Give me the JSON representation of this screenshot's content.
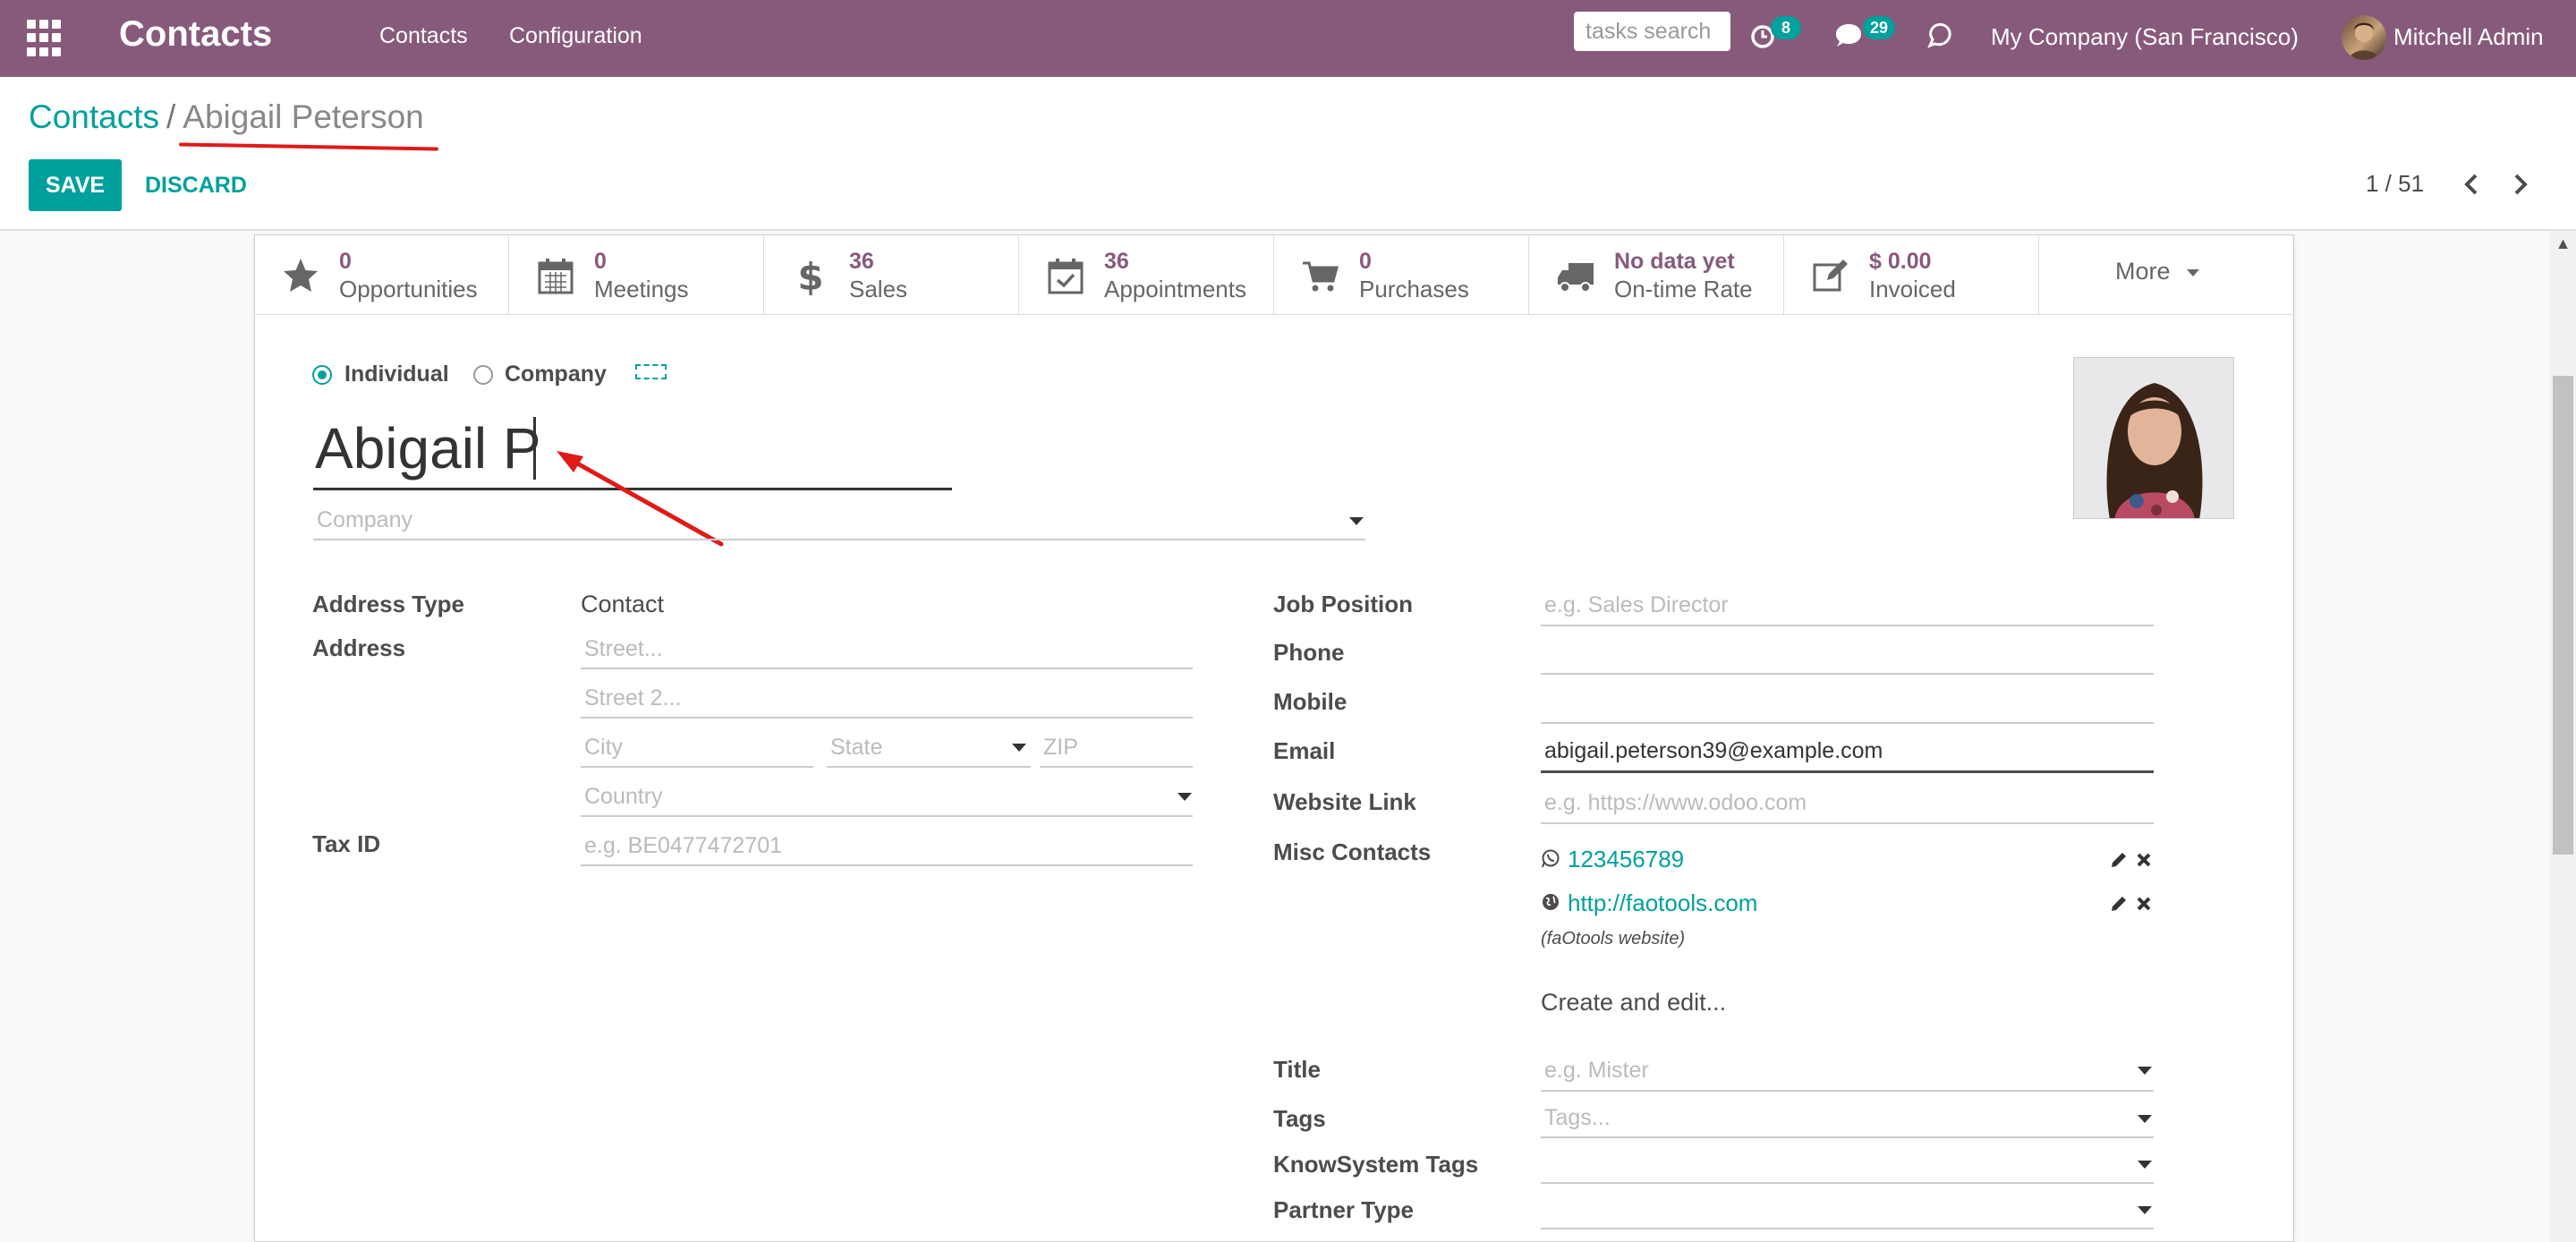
{
  "navbar": {
    "brand": "Contacts",
    "menu": [
      "Contacts",
      "Configuration"
    ],
    "search_placeholder": "tasks search",
    "activity_count": "8",
    "message_count": "29",
    "company": "My Company (San Francisco)",
    "user": "Mitchell Admin"
  },
  "breadcrumb": {
    "parent": "Contacts",
    "separator": "/",
    "current": "Abigail Peterson"
  },
  "actions": {
    "save": "SAVE",
    "discard": "DISCARD"
  },
  "pager": {
    "value": "1 / 51",
    "prev_icon": "chevron-left-icon",
    "next_icon": "chevron-right-icon"
  },
  "stat_buttons": [
    {
      "value": "0",
      "label": "Opportunities",
      "icon": "star-icon"
    },
    {
      "value": "0",
      "label": "Meetings",
      "icon": "calendar-icon"
    },
    {
      "value": "36",
      "label": "Sales",
      "icon": "dollar-icon"
    },
    {
      "value": "36",
      "label": "Appointments",
      "icon": "calendar-check-icon"
    },
    {
      "value": "0",
      "label": "Purchases",
      "icon": "cart-icon"
    },
    {
      "value": "No data yet",
      "label": "On-time Rate",
      "icon": "truck-icon"
    },
    {
      "value": "$ 0.00",
      "label": "Invoiced",
      "icon": "edit-icon"
    }
  ],
  "more_label": "More",
  "form": {
    "type_individual": "Individual",
    "type_company": "Company",
    "name_value": "Abigail P",
    "company_placeholder": "Company",
    "left": {
      "address_type_label": "Address Type",
      "address_type_value": "Contact",
      "address_label": "Address",
      "street_placeholder": "Street...",
      "street2_placeholder": "Street 2...",
      "city_placeholder": "City",
      "state_placeholder": "State",
      "zip_placeholder": "ZIP",
      "country_placeholder": "Country",
      "tax_label": "Tax ID",
      "tax_placeholder": "e.g. BE0477472701"
    },
    "right": {
      "job_label": "Job Position",
      "job_placeholder": "e.g. Sales Director",
      "phone_label": "Phone",
      "mobile_label": "Mobile",
      "email_label": "Email",
      "email_value": "abigail.peterson39@example.com",
      "website_label": "Website Link",
      "website_placeholder": "e.g. https://www.odoo.com",
      "misc_label": "Misc Contacts",
      "misc_items": [
        {
          "icon": "whatsapp-icon",
          "value": "123456789"
        },
        {
          "icon": "globe-icon",
          "value": "http://faotools.com",
          "note": "(faOtools website)"
        }
      ],
      "create_edit": "Create and edit...",
      "title_label": "Title",
      "title_placeholder": "e.g. Mister",
      "tags_label": "Tags",
      "tags_placeholder": "Tags...",
      "knowsystem_label": "KnowSystem Tags",
      "partner_type_label": "Partner Type"
    }
  }
}
